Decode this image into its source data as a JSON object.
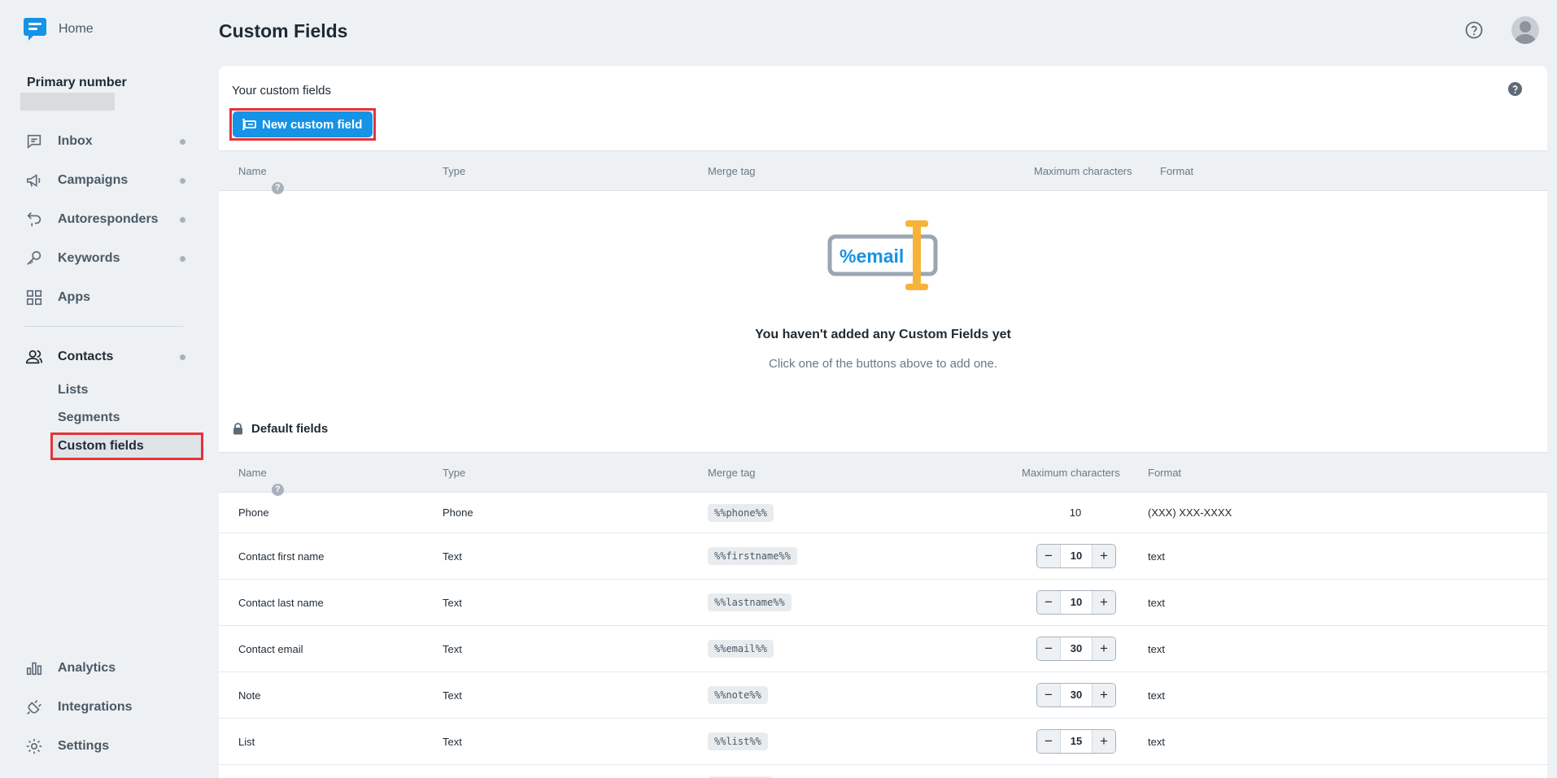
{
  "sidebar": {
    "home_label": "Home",
    "primary_number_label": "Primary number",
    "nav": [
      {
        "label": "Inbox",
        "icon": "chat-icon"
      },
      {
        "label": "Campaigns",
        "icon": "megaphone-icon"
      },
      {
        "label": "Autoresponders",
        "icon": "autoreply-icon"
      },
      {
        "label": "Keywords",
        "icon": "key-icon"
      },
      {
        "label": "Apps",
        "icon": "grid-icon"
      }
    ],
    "contacts_label": "Contacts",
    "contacts_sub": [
      "Lists",
      "Segments",
      "Custom fields"
    ],
    "bottom_nav": [
      {
        "label": "Analytics",
        "icon": "bar-chart-icon"
      },
      {
        "label": "Integrations",
        "icon": "plug-icon"
      },
      {
        "label": "Settings",
        "icon": "gear-icon"
      }
    ]
  },
  "header": {
    "title": "Custom Fields"
  },
  "custom_section": {
    "title": "Your custom fields",
    "new_button": "New custom field",
    "columns": {
      "name": "Name",
      "type": "Type",
      "merge_tag": "Merge tag",
      "max_chars": "Maximum characters",
      "format": "Format"
    },
    "illustration_text": "%email",
    "empty_title": "You haven't added any Custom Fields yet",
    "empty_subtitle": "Click one of the buttons above to add one."
  },
  "default_section": {
    "title": "Default fields",
    "columns": {
      "name": "Name",
      "type": "Type",
      "merge_tag": "Merge tag",
      "max_chars": "Maximum characters",
      "format": "Format"
    },
    "rows": [
      {
        "name": "Phone",
        "type": "Phone",
        "tag": "%%phone%%",
        "max": "10",
        "format": "(XXX) XXX-XXXX"
      },
      {
        "name": "Contact first name",
        "type": "Text",
        "tag": "%%firstname%%",
        "max": "10",
        "format": "text"
      },
      {
        "name": "Contact last name",
        "type": "Text",
        "tag": "%%lastname%%",
        "max": "10",
        "format": "text"
      },
      {
        "name": "Contact email",
        "type": "Text",
        "tag": "%%email%%",
        "max": "30",
        "format": "text"
      },
      {
        "name": "Note",
        "type": "Text",
        "tag": "%%note%%",
        "max": "30",
        "format": "text"
      },
      {
        "name": "List",
        "type": "Text",
        "tag": "%%list%%",
        "max": "15",
        "format": "text"
      }
    ]
  },
  "colors": {
    "accent": "#1593e6",
    "highlight": "#e53339",
    "illustration_yellow": "#f7b337"
  }
}
